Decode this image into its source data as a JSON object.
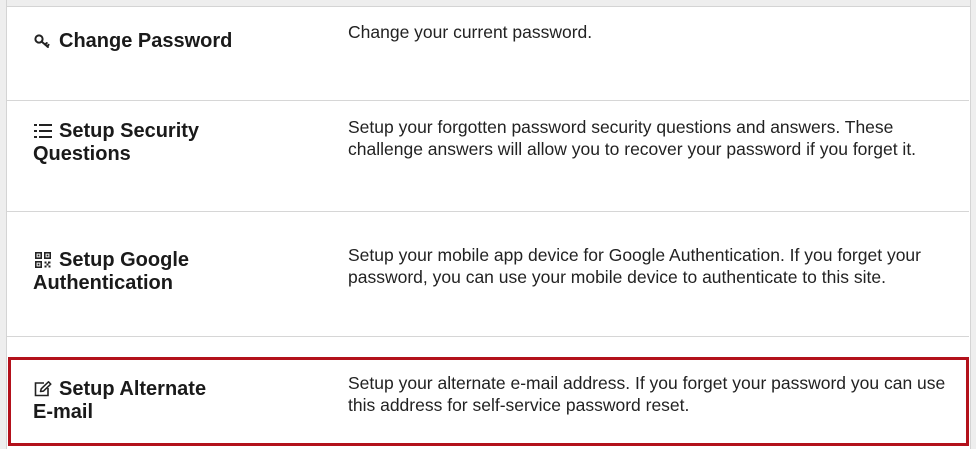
{
  "options": [
    {
      "icon": "key-icon",
      "title_line1": "Change Password",
      "title_line2": "",
      "description": "Change your current password."
    },
    {
      "icon": "list-icon",
      "title_line1": "Setup Security",
      "title_line2": "Questions",
      "description": "Setup your forgotten password security questions and answers. These challenge answers will allow you to recover your password if you forget it."
    },
    {
      "icon": "qr-code-icon",
      "title_line1": "Setup Google",
      "title_line2": "Authentication",
      "description": "Setup your mobile app device for Google Authentication. If you forget your password, you can use your mobile device to authenticate to this site."
    },
    {
      "icon": "edit-icon",
      "title_line1": "Setup Alternate",
      "title_line2": "E-mail",
      "description": "Setup your alternate e-mail address. If you forget your password you can use this address for self-service password reset."
    }
  ],
  "colors": {
    "highlight_border": "#b3111b",
    "divider": "#d6d6d6",
    "text": "#222222"
  }
}
